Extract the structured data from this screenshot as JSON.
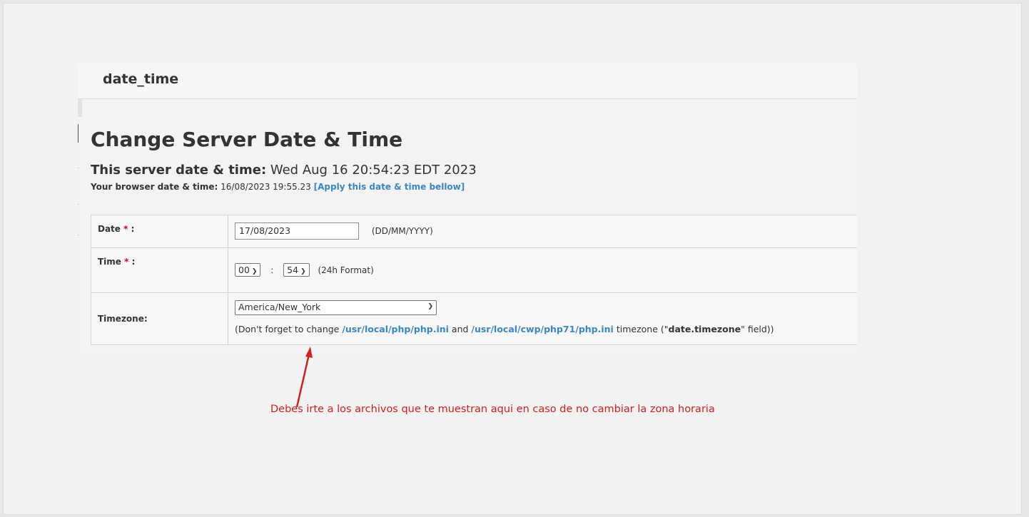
{
  "module_title": "date_time",
  "heading": "Change Server Date & Time",
  "server_time": {
    "label": "This server date & time:",
    "value": " Wed Aug 16 20:54:23 EDT 2023"
  },
  "browser_time": {
    "label": "Your browser date & time:",
    "value": " 16/08/2023 19:55.23 ",
    "apply_link": "[Apply this date & time bellow]"
  },
  "form": {
    "date": {
      "label": "Date",
      "required": "*",
      "colon": ":",
      "value": "17/08/2023",
      "format_hint": "(DD/MM/YYYY)"
    },
    "time": {
      "label": "Time",
      "required": "*",
      "colon": ":",
      "hour": "00",
      "minute": "54",
      "separator": ":",
      "format_hint": "(24h Format)"
    },
    "timezone": {
      "label": "Timezone:",
      "value": "America/New_York",
      "note_prefix": "(Don't forget to change ",
      "path1": "/usr/local/php/php.ini",
      "note_and": " and ",
      "path2": "/usr/local/cwp/php71/php.ini",
      "note_mid": " timezone (\"",
      "setting": "date.timezone",
      "note_suffix": "\" field))"
    }
  },
  "annotation": "Debes irte a los archivos que te muestran aqui en caso de no cambiar la zona horaria",
  "colors": {
    "link": "#3a87c5",
    "required": "#d0021b",
    "annotation": "#d0211c"
  },
  "icons": {
    "select_chevron": "chevron-down-icon",
    "arrow": "red-arrow-icon"
  }
}
